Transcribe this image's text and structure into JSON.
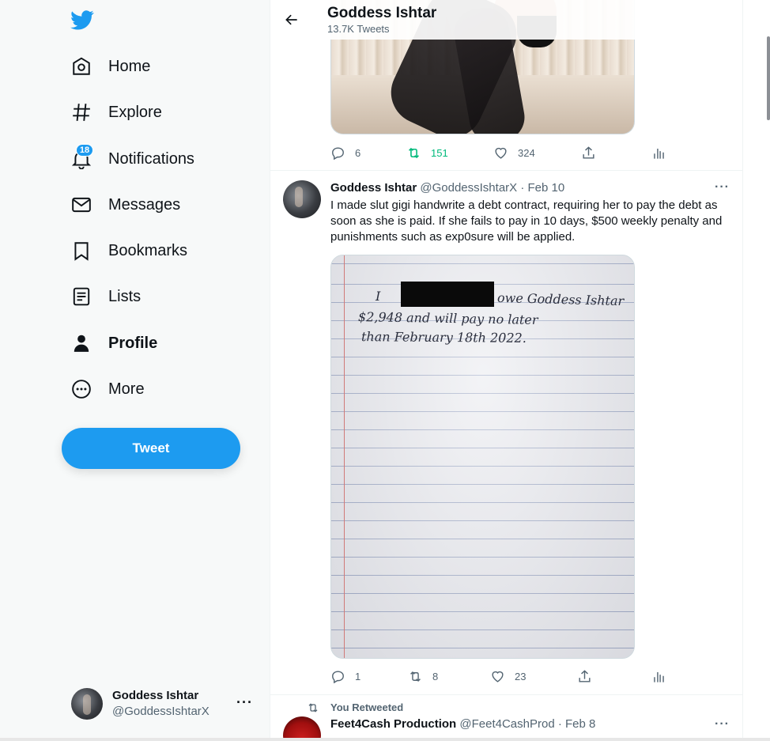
{
  "sidebar": {
    "logo_icon": "twitter-bird-icon",
    "brand_color": "#1d9bf0",
    "nav": [
      {
        "label": "Home",
        "icon": "home-icon"
      },
      {
        "label": "Explore",
        "icon": "hashtag-icon"
      },
      {
        "label": "Notifications",
        "icon": "bell-icon",
        "badge": "18"
      },
      {
        "label": "Messages",
        "icon": "envelope-icon"
      },
      {
        "label": "Bookmarks",
        "icon": "bookmark-icon"
      },
      {
        "label": "Lists",
        "icon": "list-icon"
      },
      {
        "label": "Profile",
        "icon": "person-icon",
        "active": true
      },
      {
        "label": "More",
        "icon": "more-circle-icon"
      }
    ],
    "tweet_button": "Tweet",
    "account": {
      "name": "Goddess Ishtar",
      "handle": "@GoddessIshtarX",
      "more": "···"
    }
  },
  "header": {
    "title": "Goddess Ishtar",
    "subtitle": "13.7K Tweets"
  },
  "tweet0": {
    "reply_count": "6",
    "retweet_count": "151",
    "like_count": "324"
  },
  "tweet1": {
    "name": "Goddess Ishtar",
    "meta": "@GoddessIshtarX · Feb 10",
    "more": "···",
    "text": "I made slut gigi handwrite a debt contract, requiring her to pay the debt as soon as she is paid. If she fails to pay in 10 days, $500 weekly penalty and punishments such as exp0sure will be applied.",
    "handwriting": {
      "line1a": "I",
      "line1b": "owe Goddess Ishtar",
      "line2": "$2,948   and will pay no later",
      "line3": "than  February 18th 2022."
    },
    "reply_count": "1",
    "retweet_count": "8",
    "like_count": "23"
  },
  "tweet2": {
    "retweeted_label": "You Retweeted",
    "name": "Feet4Cash Production",
    "meta": "@Feet4CashProd · Feb 8",
    "more": "···"
  },
  "colors": {
    "retweeted": "#00ba7c",
    "secondary_text": "#536471"
  }
}
